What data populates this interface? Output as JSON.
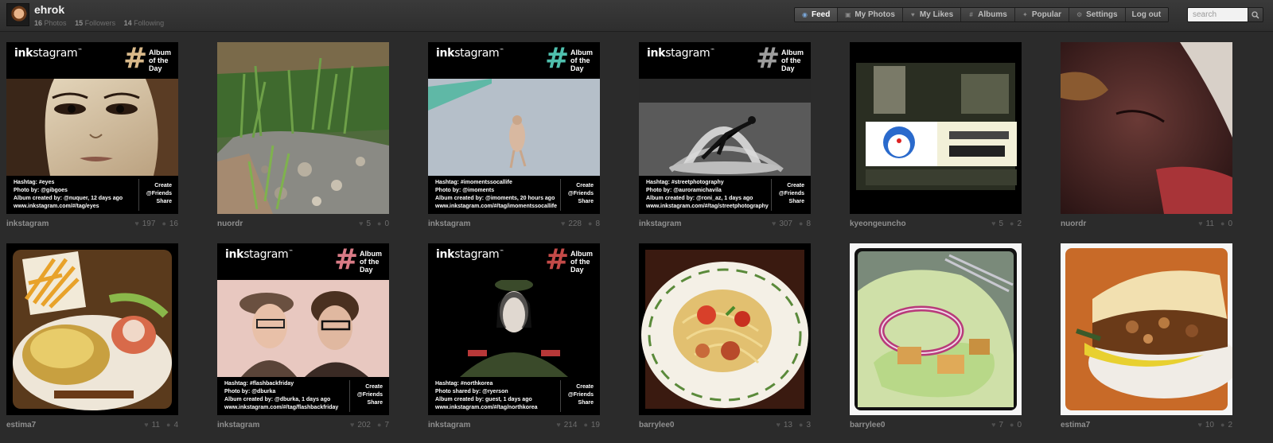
{
  "header": {
    "username": "ehrok",
    "stats": {
      "photos_count": "16",
      "photos_label": "Photos",
      "followers_count": "15",
      "followers_label": "Followers",
      "following_count": "14",
      "following_label": "Following"
    },
    "nav": [
      {
        "label": "Feed",
        "icon": "rss-icon"
      },
      {
        "label": "My Photos",
        "icon": "photo-icon"
      },
      {
        "label": "My Likes",
        "icon": "heart-icon"
      },
      {
        "label": "Albums",
        "icon": "hash-icon"
      },
      {
        "label": "Popular",
        "icon": "star-icon"
      },
      {
        "label": "Settings",
        "icon": "gear-icon"
      },
      {
        "label": "Log out",
        "icon": ""
      }
    ],
    "search_placeholder": "search"
  },
  "aotd_common": {
    "brand_prefix": "ink",
    "brand_suffix": "stagram",
    "tm": "™",
    "album_text": "Album\nof the\nDay",
    "share_text": "Create\n@Friends\nShare"
  },
  "colors": {
    "hash_eyes": "#d9b98a",
    "hash_moments": "#4fbfad",
    "hash_street": "#9c9c9c",
    "hash_flashback": "#d97b86",
    "hash_korea": "#c44a48"
  },
  "photos": [
    {
      "user": "inkstagram",
      "likes": "197",
      "comments": "16",
      "info": [
        "Hashtag: #eyes",
        "Photo by: @gibgoes",
        "Album created by: @nuquer, 12 days ago",
        "www.inkstagram.com/#/tag/eyes"
      ]
    },
    {
      "user": "nuordr",
      "likes": "5",
      "comments": "0"
    },
    {
      "user": "inkstagram",
      "likes": "228",
      "comments": "8",
      "info": [
        "Hashtag: #imomentssocallife",
        "Photo by: @imoments",
        "Album created by: @imoments, 20 hours ago",
        "www.inkstagram.com/#/tag/imomentssocallife"
      ]
    },
    {
      "user": "inkstagram",
      "likes": "307",
      "comments": "8",
      "info": [
        "Hashtag: #streetphotography",
        "Photo by: @auroramichavila",
        "Album created by: @roni_az, 1 days ago",
        "www.inkstagram.com/#/tag/streetphotography"
      ]
    },
    {
      "user": "kyeongeuncho",
      "likes": "5",
      "comments": "2"
    },
    {
      "user": "nuordr",
      "likes": "11",
      "comments": "0"
    },
    {
      "user": "estima7",
      "likes": "11",
      "comments": "4"
    },
    {
      "user": "inkstagram",
      "likes": "202",
      "comments": "7",
      "info": [
        "Hashtag: #flashbackfriday",
        "Photo by: @dburka",
        "Album created by: @dburka, 1 days ago",
        "www.inkstagram.com/#/tag/flashbackfriday"
      ]
    },
    {
      "user": "inkstagram",
      "likes": "214",
      "comments": "19",
      "info": [
        "Hashtag: #northkorea",
        "Photo shared by: @ryerson",
        "Album created by: guest, 1 days ago",
        "www.inkstagram.com/#/tag/northkorea"
      ]
    },
    {
      "user": "barrylee0",
      "likes": "13",
      "comments": "3"
    },
    {
      "user": "barrylee0",
      "likes": "7",
      "comments": "0"
    },
    {
      "user": "estima7",
      "likes": "10",
      "comments": "2"
    }
  ]
}
